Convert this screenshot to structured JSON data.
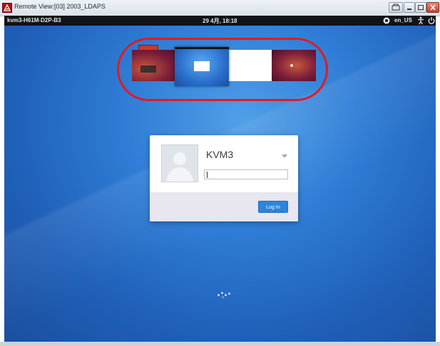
{
  "window": {
    "title": "Remote View:[03] 2003_LDAPS",
    "buttons": [
      "restore-remote-icon",
      "minimize-icon",
      "maximize-icon",
      "close-icon"
    ]
  },
  "top_bar": {
    "host": "kvm3-H61M-D2P-B3",
    "clock": "29 4月, 18:18",
    "locale": "en_US",
    "icons": [
      "network-icon",
      "accessibility-icon",
      "power-icon"
    ]
  },
  "workspace_switcher": {
    "workspaces": [
      "workspace-1",
      "workspace-2",
      "workspace-3",
      "workspace-4"
    ],
    "active_index": 1,
    "highlight_color": "#e01b24"
  },
  "login": {
    "username": "KVM3",
    "password_value": "",
    "button_label": "Log In",
    "accent": "#2f84d8"
  }
}
